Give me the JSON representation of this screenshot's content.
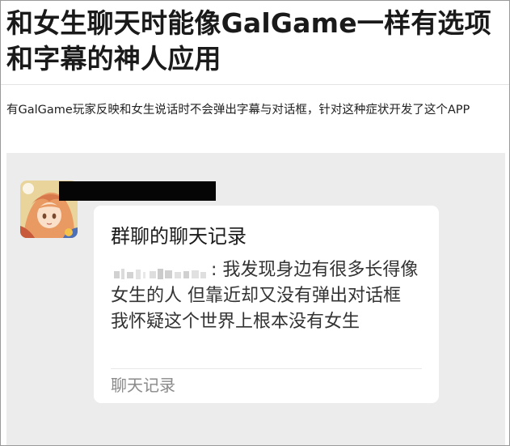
{
  "article": {
    "title": "和女生聊天时能像GalGame一样有选项和字幕的神人应用",
    "summary": "有GalGame玩家反映和女生说话时不会弹出字幕与对话框，针对这种症状开发了这个APP"
  },
  "chat": {
    "card_title": "群聊的聊天记录",
    "message": ": 我发现身边有很多长得像女生的人 但靠近却又没有弹出对话框 我怀疑这个世界上根本没有女生",
    "footer_label": "聊天记录"
  },
  "colors": {
    "chat_background": "#ececec",
    "bubble_background": "#ffffff",
    "redaction": "#050505",
    "footer_text": "#8a8a8a"
  },
  "icons": {
    "avatar": "anime-character-avatar"
  }
}
